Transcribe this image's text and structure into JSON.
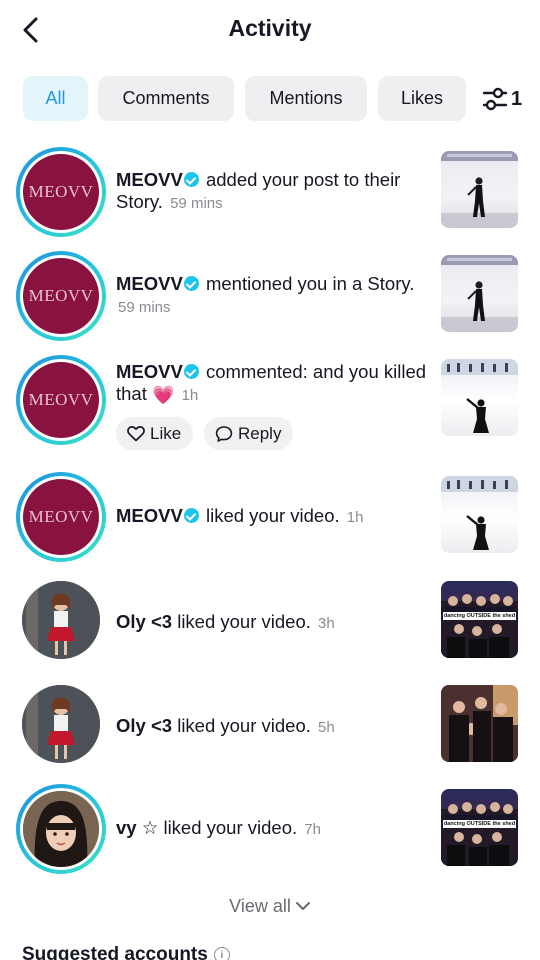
{
  "header": {
    "title": "Activity"
  },
  "filters": {
    "tabs": [
      {
        "label": "All",
        "active": true
      },
      {
        "label": "Comments",
        "active": false
      },
      {
        "label": "Mentions",
        "active": false
      },
      {
        "label": "Likes",
        "active": false
      }
    ],
    "filter_count": "1",
    "filter_icon": "sliders-icon"
  },
  "notifications": [
    {
      "user": "MEOVV",
      "verified": true,
      "avatar_text": "MEOVV",
      "action": "added your post to their Story.",
      "time": "59 mins"
    },
    {
      "user": "MEOVV",
      "verified": true,
      "avatar_text": "MEOVV",
      "action": "mentioned you in a Story.",
      "time": "59 mins"
    },
    {
      "user": "MEOVV",
      "verified": true,
      "avatar_text": "MEOVV",
      "action": "commented: and you killed that",
      "emoji": "💗",
      "time": "1h",
      "like_label": "Like",
      "reply_label": "Reply"
    },
    {
      "user": "MEOVV",
      "verified": true,
      "avatar_text": "MEOVV",
      "action": "liked your video.",
      "time": "1h"
    },
    {
      "user": "Oly <3",
      "verified": false,
      "action": "liked your video.",
      "time": "3h"
    },
    {
      "user": "Oly <3",
      "verified": false,
      "action": "liked your video.",
      "time": "5h"
    },
    {
      "user": "vy ☆",
      "verified": false,
      "action": "liked your video.",
      "time": "7h"
    }
  ],
  "thumb_captions": {
    "group": "dancing OUTSIDE the shed"
  },
  "footer": {
    "view_all": "View all",
    "suggested_title": "Suggested accounts"
  },
  "colors": {
    "accent": "#1e9ad8",
    "active_chip_bg": "#e3f5fb",
    "brand_avatar": "#8a1240",
    "verified": "#20c4e8",
    "ring_start": "#1f8fe0",
    "ring_end": "#3fe0c5"
  }
}
